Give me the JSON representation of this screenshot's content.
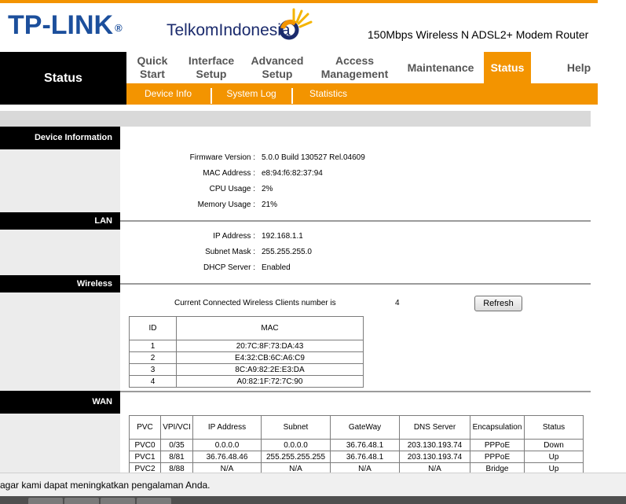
{
  "header": {
    "brand": "TP-LINK",
    "brand_reg": "®",
    "partner": "TelkomIndonesia",
    "model": "150Mbps Wireless N ADSL2+ Modem Router"
  },
  "nav": {
    "current": "Status",
    "items": [
      {
        "line1": "Quick",
        "line2": "Start"
      },
      {
        "line1": "Interface",
        "line2": "Setup"
      },
      {
        "line1": "Advanced",
        "line2": "Setup"
      },
      {
        "line1": "Access",
        "line2": "Management"
      },
      {
        "line1": "Maintenance",
        "line2": ""
      },
      {
        "line1": "Status",
        "line2": ""
      },
      {
        "line1": "Help",
        "line2": ""
      }
    ],
    "sub": [
      "Device Info",
      "System Log",
      "Statistics"
    ]
  },
  "device": {
    "heading": "Device Information",
    "rows": [
      {
        "label": "Firmware Version :",
        "value": "5.0.0 Build 130527 Rel.04609"
      },
      {
        "label": "MAC Address :",
        "value": "e8:94:f6:82:37:94"
      },
      {
        "label": "CPU Usage :",
        "value": "2%"
      },
      {
        "label": "Memory Usage :",
        "value": "21%"
      }
    ]
  },
  "lan": {
    "heading": "LAN",
    "rows": [
      {
        "label": "IP Address :",
        "value": "192.168.1.1"
      },
      {
        "label": "Subnet Mask :",
        "value": "255.255.255.0"
      },
      {
        "label": "DHCP Server :",
        "value": "Enabled"
      }
    ]
  },
  "wireless": {
    "heading": "Wireless",
    "clients_label": "Current Connected Wireless Clients number is",
    "clients_count": "4",
    "refresh_label": "Refresh",
    "columns": [
      "ID",
      "MAC"
    ],
    "rows": [
      [
        "1",
        "20:7C:8F:73:DA:43"
      ],
      [
        "2",
        "E4:32:CB:6C:A6:C9"
      ],
      [
        "3",
        "8C:A9:82:2E:E3:DA"
      ],
      [
        "4",
        "A0:82:1F:72:7C:90"
      ]
    ]
  },
  "wan": {
    "heading": "WAN",
    "columns": [
      "PVC",
      "VPI/VCI",
      "IP Address",
      "Subnet",
      "GateWay",
      "DNS Server",
      "Encapsulation",
      "Status"
    ],
    "rows": [
      [
        "PVC0",
        "0/35",
        "0.0.0.0",
        "0.0.0.0",
        "36.76.48.1",
        "203.130.193.74",
        "PPPoE",
        "Down"
      ],
      [
        "PVC1",
        "8/81",
        "36.76.48.46",
        "255.255.255.255",
        "36.76.48.1",
        "203.130.193.74",
        "PPPoE",
        "Up"
      ],
      [
        "PVC2",
        "8/88",
        "N/A",
        "N/A",
        "N/A",
        "N/A",
        "Bridge",
        "Up"
      ]
    ]
  },
  "statusbar": {
    "text": "agar kami dapat meningkatkan pengalaman Anda."
  },
  "colors": {
    "accent": "#f39400",
    "brand_blue": "#1c4f9c",
    "nav_black": "#000000"
  }
}
